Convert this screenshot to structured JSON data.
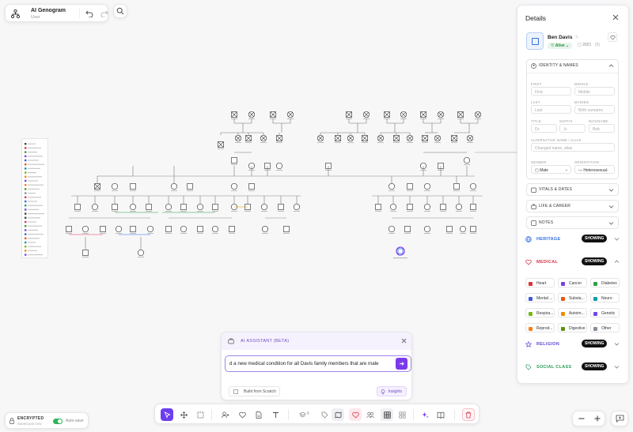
{
  "app": {
    "title": "AI Genogram",
    "user": "User"
  },
  "details": {
    "header": "Details",
    "person": {
      "name": "Ben Davis",
      "status": "Alive",
      "birth_year": "2021",
      "age": "(5)"
    },
    "identity": {
      "section_label": "IDENTITY & NAMES",
      "first_label": "FIRST",
      "first_placeholder": "First",
      "middle_label": "MIDDLE",
      "middle_placeholder": "Middle",
      "last_label": "LAST",
      "last_placeholder": "Last",
      "maiden_label": "MAIDEN",
      "maiden_placeholder": "Birth surname",
      "title_label": "TITLE",
      "title_placeholder": "Dr.",
      "suffix_label": "SUFFIX",
      "suffix_placeholder": "Jr.",
      "nickname_label": "NICKNAME",
      "nickname_placeholder": "Bob",
      "alt_label": "ALTERNATIVE NAME / ALIAS",
      "alt_placeholder": "Changed name, alias",
      "gender_label": "GENDER",
      "gender_value": "Male",
      "orientation_label": "ORIENTATION",
      "orientation_value": "Heterosexual-"
    },
    "collapsed_sections": [
      "VITALS & DATES",
      "LIFE & CAREER",
      "NOTES"
    ],
    "categories": {
      "heritage": {
        "label": "HERITAGE",
        "state": "SHOWING",
        "color": "#2f6fe0"
      },
      "medical": {
        "label": "MEDICAL",
        "state": "SHOWING",
        "color": "#d9374b"
      },
      "religion": {
        "label": "RELIGION",
        "state": "SHOWING",
        "color": "#5b4bd4"
      },
      "social": {
        "label": "SOCIAL CLASS",
        "state": "SHOWING",
        "color": "#2a9d5c"
      }
    },
    "medical_conditions": [
      {
        "label": "Heart",
        "color": "#e03131"
      },
      {
        "label": "Cancer",
        "color": "#7b3fe4"
      },
      {
        "label": "Diabetes",
        "color": "#2f9e44"
      },
      {
        "label": "Mental ...",
        "color": "#3b5bdb"
      },
      {
        "label": "Substa...",
        "color": "#e8590c"
      },
      {
        "label": "Neuro",
        "color": "#1098ad"
      },
      {
        "label": "Respira...",
        "color": "#74b816"
      },
      {
        "label": "Autoim...",
        "color": "#f08c00"
      },
      {
        "label": "Genetic",
        "color": "#7048e8"
      },
      {
        "label": "Reprod...",
        "color": "#fd7e14"
      },
      {
        "label": "Digestive",
        "color": "#5c940d"
      },
      {
        "label": "Other",
        "color": "#868e96"
      }
    ]
  },
  "ai": {
    "title": "AI ASSISTANT (BETA)",
    "input_value": "d a new medical condition for all Davis family members that are male",
    "build_label": "Build from Scratch",
    "insights_label": "Insights"
  },
  "toolbar": {
    "layer_count": "6"
  },
  "status": {
    "encrypted": "ENCRYPTED",
    "saved": "Saved just now",
    "autosave": "Auto-save"
  }
}
